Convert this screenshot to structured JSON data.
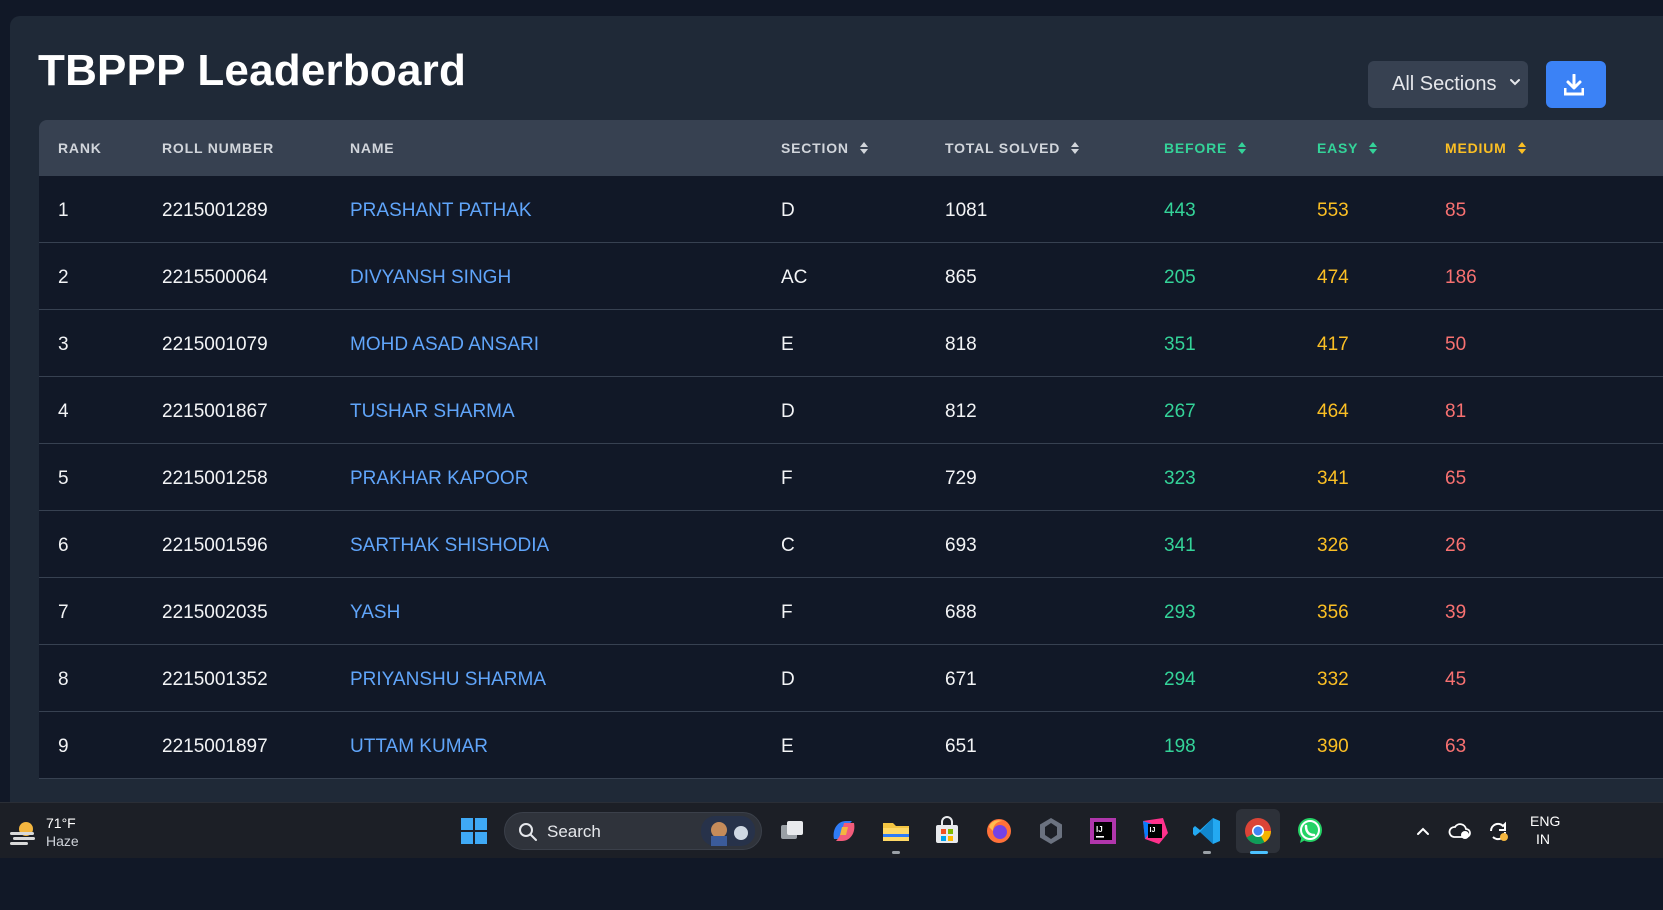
{
  "page": {
    "title": "TBPPP Leaderboard",
    "section_filter": "All Sections"
  },
  "table": {
    "headers": {
      "rank": "RANK",
      "roll": "ROLL NUMBER",
      "name": "NAME",
      "section": "SECTION",
      "total": "TOTAL SOLVED",
      "before": "BEFORE",
      "easy": "EASY",
      "medium": "MEDIUM"
    },
    "rows": [
      {
        "rank": "1",
        "roll": "2215001289",
        "name": "PRASHANT PATHAK",
        "section": "D",
        "total": "1081",
        "before": "443",
        "easy": "553",
        "medium": "85"
      },
      {
        "rank": "2",
        "roll": "2215500064",
        "name": "DIVYANSH SINGH",
        "section": "AC",
        "total": "865",
        "before": "205",
        "easy": "474",
        "medium": "186"
      },
      {
        "rank": "3",
        "roll": "2215001079",
        "name": "MOHD ASAD ANSARI",
        "section": "E",
        "total": "818",
        "before": "351",
        "easy": "417",
        "medium": "50"
      },
      {
        "rank": "4",
        "roll": "2215001867",
        "name": "TUSHAR SHARMA",
        "section": "D",
        "total": "812",
        "before": "267",
        "easy": "464",
        "medium": "81"
      },
      {
        "rank": "5",
        "roll": "2215001258",
        "name": "PRAKHAR KAPOOR",
        "section": "F",
        "total": "729",
        "before": "323",
        "easy": "341",
        "medium": "65"
      },
      {
        "rank": "6",
        "roll": "2215001596",
        "name": "SARTHAK SHISHODIA",
        "section": "C",
        "total": "693",
        "before": "341",
        "easy": "326",
        "medium": "26"
      },
      {
        "rank": "7",
        "roll": "2215002035",
        "name": "YASH",
        "section": "F",
        "total": "688",
        "before": "293",
        "easy": "356",
        "medium": "39"
      },
      {
        "rank": "8",
        "roll": "2215001352",
        "name": "PRIYANSHU SHARMA",
        "section": "D",
        "total": "671",
        "before": "294",
        "easy": "332",
        "medium": "45"
      },
      {
        "rank": "9",
        "roll": "2215001897",
        "name": "UTTAM KUMAR",
        "section": "E",
        "total": "651",
        "before": "198",
        "easy": "390",
        "medium": "63"
      }
    ]
  },
  "colors": {
    "before": "#34d399",
    "easy": "#fbbf24",
    "medium": "#f87171",
    "link": "#60a5fa",
    "accent": "#3b82f6"
  },
  "taskbar": {
    "weather_temp": "71°F",
    "weather_cond": "Haze",
    "search_label": "Search",
    "lang": "ENG",
    "region": "IN",
    "icons": [
      "windows-start-icon",
      "task-view-icon",
      "copilot-icon",
      "file-explorer-icon",
      "microsoft-store-icon",
      "firefox-icon",
      "unity-icon",
      "intellij-idea-icon",
      "jetbrains-toolbox-icon",
      "vscode-icon",
      "chrome-icon",
      "whatsapp-icon"
    ]
  }
}
